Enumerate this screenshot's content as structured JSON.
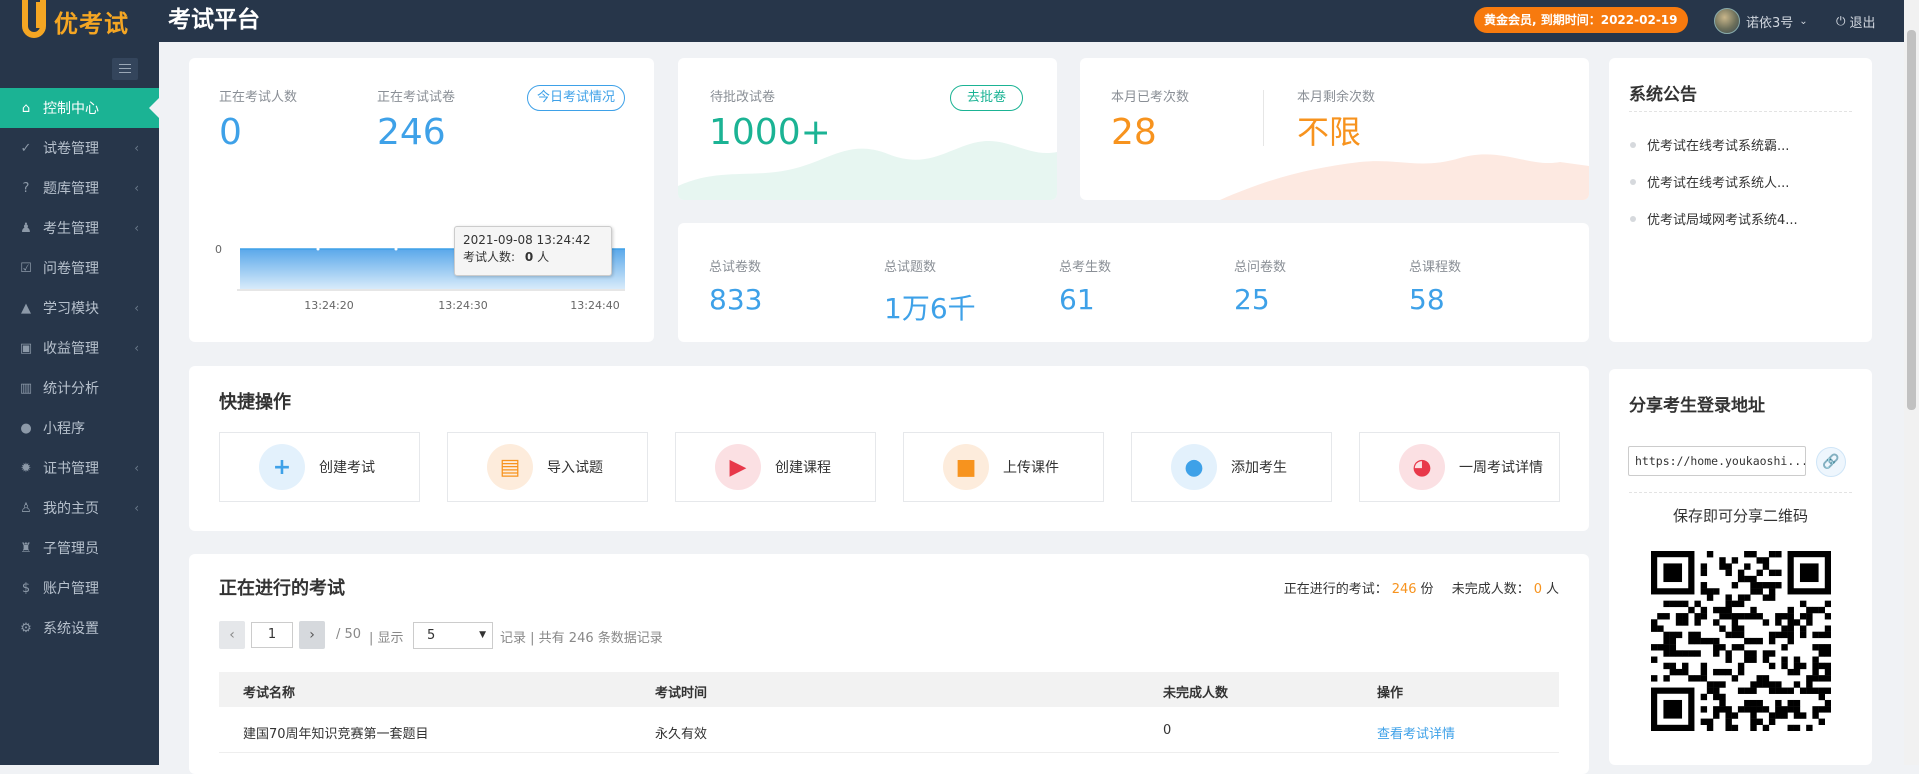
{
  "app": {
    "logo_text": "优考试",
    "title": "考试平台"
  },
  "header": {
    "member_badge": "黄金会员, 到期时间：2022-02-19",
    "username": "诺依3号",
    "logout": "退出"
  },
  "sidebar": {
    "items": [
      {
        "label": "控制中心",
        "icon": "home-icon",
        "active": true,
        "arrow": false
      },
      {
        "label": "试卷管理",
        "icon": "check-circle-icon",
        "arrow": true
      },
      {
        "label": "题库管理",
        "icon": "question-circle-icon",
        "arrow": true
      },
      {
        "label": "考生管理",
        "icon": "user-icon",
        "arrow": true
      },
      {
        "label": "问卷管理",
        "icon": "checkbox-icon",
        "arrow": false
      },
      {
        "label": "学习模块",
        "icon": "graduation-cap-icon",
        "arrow": true
      },
      {
        "label": "收益管理",
        "icon": "money-icon",
        "arrow": true
      },
      {
        "label": "统计分析",
        "icon": "bar-chart-icon",
        "arrow": false
      },
      {
        "label": "小程序",
        "icon": "wechat-icon",
        "arrow": false
      },
      {
        "label": "证书管理",
        "icon": "certificate-icon",
        "arrow": true
      },
      {
        "label": "我的主页",
        "icon": "person-home-icon",
        "arrow": true
      },
      {
        "label": "子管理员",
        "icon": "lock-user-icon",
        "arrow": false
      },
      {
        "label": "账户管理",
        "icon": "dollar-icon",
        "arrow": false
      },
      {
        "label": "系统设置",
        "icon": "gear-icon",
        "arrow": false
      }
    ]
  },
  "stats": {
    "exam_people_label": "正在考试人数",
    "exam_people": "0",
    "exam_papers_label": "正在考试试卷",
    "exam_papers": "246",
    "today_btn": "今日考试情况",
    "pending_label": "待批改试卷",
    "pending": "1000+",
    "grade_btn": "去批卷",
    "month_used_label": "本月已考次数",
    "month_used": "28",
    "month_left_label": "本月剩余次数",
    "month_left": "不限",
    "totals": [
      {
        "label": "总试卷数",
        "value": "833"
      },
      {
        "label": "总试题数",
        "value": "1万6千"
      },
      {
        "label": "总考生数",
        "value": "61"
      },
      {
        "label": "总问卷数",
        "value": "25"
      },
      {
        "label": "总课程数",
        "value": "58"
      }
    ]
  },
  "mini_chart": {
    "y_tick": "0",
    "x_ticks": [
      "13:24:20",
      "13:24:30",
      "13:24:40"
    ],
    "tooltip": {
      "time": "2021-09-08 13:24:42",
      "label": "考试人数:",
      "value": "0",
      "unit": "人"
    },
    "color": "#3ea1e8"
  },
  "notice": {
    "title": "系统公告",
    "items": [
      "优考试在线考试系统霸...",
      "优考试在线考试系统人...",
      "优考试局域网考试系统4..."
    ]
  },
  "quick": {
    "title": "快捷操作",
    "items": [
      {
        "label": "创建考试",
        "icon": "plus-icon",
        "color": "#3ea1e8",
        "bg": "#e3f1fc",
        "glyph": "+"
      },
      {
        "label": "导入试题",
        "icon": "document-icon",
        "color": "#f7931e",
        "bg": "#fdecdc",
        "glyph": "▤"
      },
      {
        "label": "创建课程",
        "icon": "video-play-icon",
        "color": "#e8384a",
        "bg": "#fbe0e3",
        "glyph": "▶"
      },
      {
        "label": "上传课件",
        "icon": "folder-icon",
        "color": "#f7931e",
        "bg": "#fdecdc",
        "glyph": "■"
      },
      {
        "label": "添加考生",
        "icon": "user-add-icon",
        "color": "#3ea1e8",
        "bg": "#e3f1fc",
        "glyph": "●"
      },
      {
        "label": "一周考试详情",
        "icon": "pie-chart-icon",
        "color": "#e8384a",
        "bg": "#fbe0e3",
        "glyph": "◕"
      }
    ]
  },
  "share": {
    "title": "分享考生登录地址",
    "url": "https://home.youkaoshi...",
    "hint": "保存即可分享二维码"
  },
  "ongoing": {
    "title": "正在进行的考试",
    "count_label": "正在进行的考试：",
    "count": "246",
    "count_unit": "份",
    "unfinished_label": "未完成人数：",
    "unfinished": "0",
    "unfinished_unit": "人",
    "pager": {
      "page": "1",
      "total_pages": "/ 50",
      "show": "显示",
      "page_size": "5",
      "records": "记录",
      "total_text": "共有 246 条数据记录"
    },
    "columns": [
      "考试名称",
      "考试时间",
      "未完成人数",
      "操作"
    ],
    "rows": [
      {
        "name": "建国70周年知识竞赛第一套题目",
        "time": "永久有效",
        "unfinished": "0",
        "action": "查看考试详情"
      }
    ]
  }
}
